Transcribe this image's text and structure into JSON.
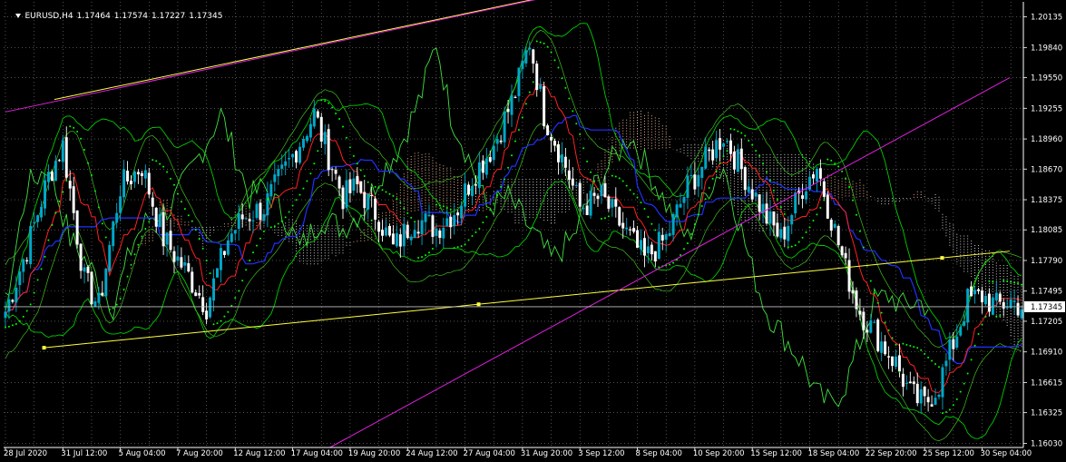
{
  "header": {
    "symbol": "EURUSD,H4",
    "open": "1.17464",
    "high": "1.17574",
    "low": "1.17227",
    "close": "1.17345"
  },
  "colors": {
    "background": "#000000",
    "grid": "#808080",
    "bull_candle": "#00a8c8",
    "bear_candle": "#ffffff",
    "bollinger": "#00cc00",
    "envelope": "#40c020",
    "tenkan": "#ff2020",
    "kijun": "#2030ff",
    "chikou": "#40e040",
    "kumo_bull": "#e8b090",
    "kumo_bear": "#c8c8c8",
    "psar": "#00ff00",
    "trendline_yellow": "#ffff40",
    "trendline_magenta": "#e020e0",
    "price_line": "#c0c0c0"
  },
  "chart_data": {
    "type": "candlestick",
    "symbol": "EURUSD",
    "timeframe": "H4",
    "y_ticks": [
      "1.20135",
      "1.19840",
      "1.19550",
      "1.19255",
      "1.18960",
      "1.18670",
      "1.18375",
      "1.18085",
      "1.17790",
      "1.17495",
      "1.17205",
      "1.16910",
      "1.16615",
      "1.16325",
      "1.16030"
    ],
    "ylim": [
      1.1599,
      1.2028
    ],
    "current_price": "1.17345",
    "x_ticks": [
      "28 Jul 2020",
      "31 Jul 12:00",
      "5 Aug 04:00",
      "7 Aug 20:00",
      "12 Aug 12:00",
      "17 Aug 04:00",
      "19 Aug 20:00",
      "24 Aug 12:00",
      "27 Aug 04:00",
      "31 Aug 20:00",
      "3 Sep 12:00",
      "8 Sep 04:00",
      "10 Sep 20:00",
      "15 Sep 12:00",
      "18 Sep 04:00",
      "22 Sep 20:00",
      "25 Sep 12:00",
      "30 Sep 04:00"
    ],
    "x_tick_bars": [
      0,
      16,
      32,
      48,
      64,
      80,
      96,
      112,
      128,
      144,
      160,
      176,
      192,
      208,
      224,
      240,
      256,
      272
    ],
    "bar_count": 284,
    "anchors": [
      [
        0,
        1.173
      ],
      [
        6,
        1.179
      ],
      [
        12,
        1.186
      ],
      [
        16,
        1.189
      ],
      [
        22,
        1.176
      ],
      [
        26,
        1.1735
      ],
      [
        32,
        1.185
      ],
      [
        38,
        1.187
      ],
      [
        44,
        1.18
      ],
      [
        50,
        1.177
      ],
      [
        56,
        1.1735
      ],
      [
        62,
        1.18
      ],
      [
        66,
        1.182
      ],
      [
        72,
        1.183
      ],
      [
        80,
        1.188
      ],
      [
        86,
        1.192
      ],
      [
        90,
        1.188
      ],
      [
        94,
        1.184
      ],
      [
        98,
        1.185
      ],
      [
        104,
        1.182
      ],
      [
        108,
        1.179
      ],
      [
        114,
        1.182
      ],
      [
        120,
        1.181
      ],
      [
        126,
        1.183
      ],
      [
        130,
        1.186
      ],
      [
        136,
        1.189
      ],
      [
        142,
        1.194
      ],
      [
        146,
        1.199
      ],
      [
        150,
        1.192
      ],
      [
        156,
        1.187
      ],
      [
        160,
        1.183
      ],
      [
        166,
        1.184
      ],
      [
        172,
        1.181
      ],
      [
        178,
        1.178
      ],
      [
        184,
        1.18
      ],
      [
        190,
        1.185
      ],
      [
        196,
        1.188
      ],
      [
        200,
        1.19
      ],
      [
        206,
        1.186
      ],
      [
        212,
        1.182
      ],
      [
        216,
        1.18
      ],
      [
        222,
        1.185
      ],
      [
        226,
        1.187
      ],
      [
        230,
        1.182
      ],
      [
        234,
        1.177
      ],
      [
        238,
        1.173
      ],
      [
        242,
        1.171
      ],
      [
        248,
        1.168
      ],
      [
        252,
        1.165
      ],
      [
        256,
        1.164
      ],
      [
        260,
        1.166
      ],
      [
        264,
        1.17
      ],
      [
        268,
        1.174
      ],
      [
        272,
        1.1745
      ],
      [
        276,
        1.1735
      ],
      [
        280,
        1.174
      ],
      [
        283,
        1.1735
      ]
    ],
    "trendlines": [
      {
        "color": "yellow",
        "from": [
          "31 Jul 04:00",
          1.1934
        ],
        "to": [
          "2 Sep 00:00",
          1.2036
        ]
      },
      {
        "color": "yellow",
        "from": [
          "30 Jul 12:00",
          1.1695
        ],
        "to": [
          "1 Oct 00:00",
          1.1788
        ]
      },
      {
        "color": "magenta",
        "from": [
          "28 Jul 00:00",
          1.1922
        ],
        "to": [
          "2 Sep 04:00",
          1.2036
        ]
      },
      {
        "color": "magenta",
        "from": [
          "18 Aug 00:00",
          1.1599
        ],
        "to": [
          "1 Oct 00:00",
          1.1955
        ]
      }
    ]
  }
}
